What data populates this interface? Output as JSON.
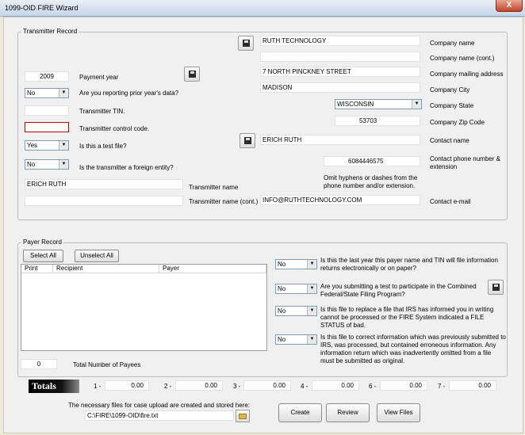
{
  "window": {
    "title": "1099-OID FIRE Wizard",
    "close_label": "X"
  },
  "transmitter": {
    "legend": "Transmitter Record",
    "payment_year": {
      "value": "2009",
      "label": "Payment year"
    },
    "prior_year": {
      "value": "No",
      "label": "Are you reporting prior year's data?"
    },
    "tin": {
      "value": "",
      "label": "Transmitter TIN."
    },
    "control_code": {
      "value": "",
      "label": "Transmitter control code."
    },
    "test_file": {
      "value": "Yes",
      "label": "Is this a test file?"
    },
    "foreign": {
      "value": "No",
      "label": "Is the transmitter a foreign entity?"
    },
    "name": {
      "value": "ERICH RUTH",
      "label": "Transmitter name"
    },
    "name_cont": {
      "value": "",
      "label": "Transmitter name (cont.)"
    },
    "company_name": {
      "value": "RUTH TECHNOLOGY",
      "label": "Company name"
    },
    "company_name_cont": {
      "value": "",
      "label": "Company name (cont.)"
    },
    "mailing_address": {
      "value": "7 NORTH PINCKNEY STREET",
      "label": "Company mailing address"
    },
    "city": {
      "value": "MADISON",
      "label": "Company City"
    },
    "state": {
      "value": "WISCONSIN",
      "label": "Company State"
    },
    "zip": {
      "value": "53703",
      "label": "Company Zip Code"
    },
    "contact_name": {
      "value": "ERICH RUTH",
      "label": "Contact name"
    },
    "phone": {
      "value": "6084446575",
      "label": "Contact phone number & extension"
    },
    "phone_note": "Omit hyphens or dashes from the phone number and/or extension.",
    "email": {
      "value": "INFO@RUTHTECHNOLOGY.COM",
      "label": "Contact e-mail"
    }
  },
  "payer": {
    "legend": "Payer Record",
    "select_all": "Select All",
    "unselect_all": "Unselect All",
    "columns": [
      "Print",
      "Recipient",
      "Payer"
    ],
    "total_payees": {
      "value": "0",
      "label": "Total Number of Payees"
    },
    "questions": [
      {
        "value": "No",
        "text": "Is this the last year this payer name and TIN will file information returns electronically or on paper?"
      },
      {
        "value": "No",
        "text": "Are you submitting a test to participate in the Combined Federal/State Filing Program?"
      },
      {
        "value": "No",
        "text": "Is this file to replace a file that IRS has informed you in writing cannot be processed or the FIRE System indicated a FILE STATUS of bad."
      },
      {
        "value": "No",
        "text": "Is this file to correct information which was previously submitted to IRS, was processed, but contained erroneous information. Any information return which was inadvertently omitted from a file must be submitted as original."
      }
    ]
  },
  "totals": {
    "label": "Totals",
    "items": [
      {
        "label": "1 -",
        "value": "0.00"
      },
      {
        "label": "2 -",
        "value": "0.00"
      },
      {
        "label": "3 -",
        "value": "0.00"
      },
      {
        "label": "4 -",
        "value": "0.00"
      },
      {
        "label": "6 -",
        "value": "0.00"
      },
      {
        "label": "7 -",
        "value": "0.00"
      }
    ]
  },
  "footer": {
    "note": "The necessary files for case upload are created and stored here:",
    "path": "C:\\FIRE\\1099-OID\\fire.txt",
    "create": "Create",
    "review": "Review",
    "view_files": "View Files"
  },
  "icons": {
    "save": "floppy-disk-icon",
    "folder": "folder-open-icon"
  }
}
